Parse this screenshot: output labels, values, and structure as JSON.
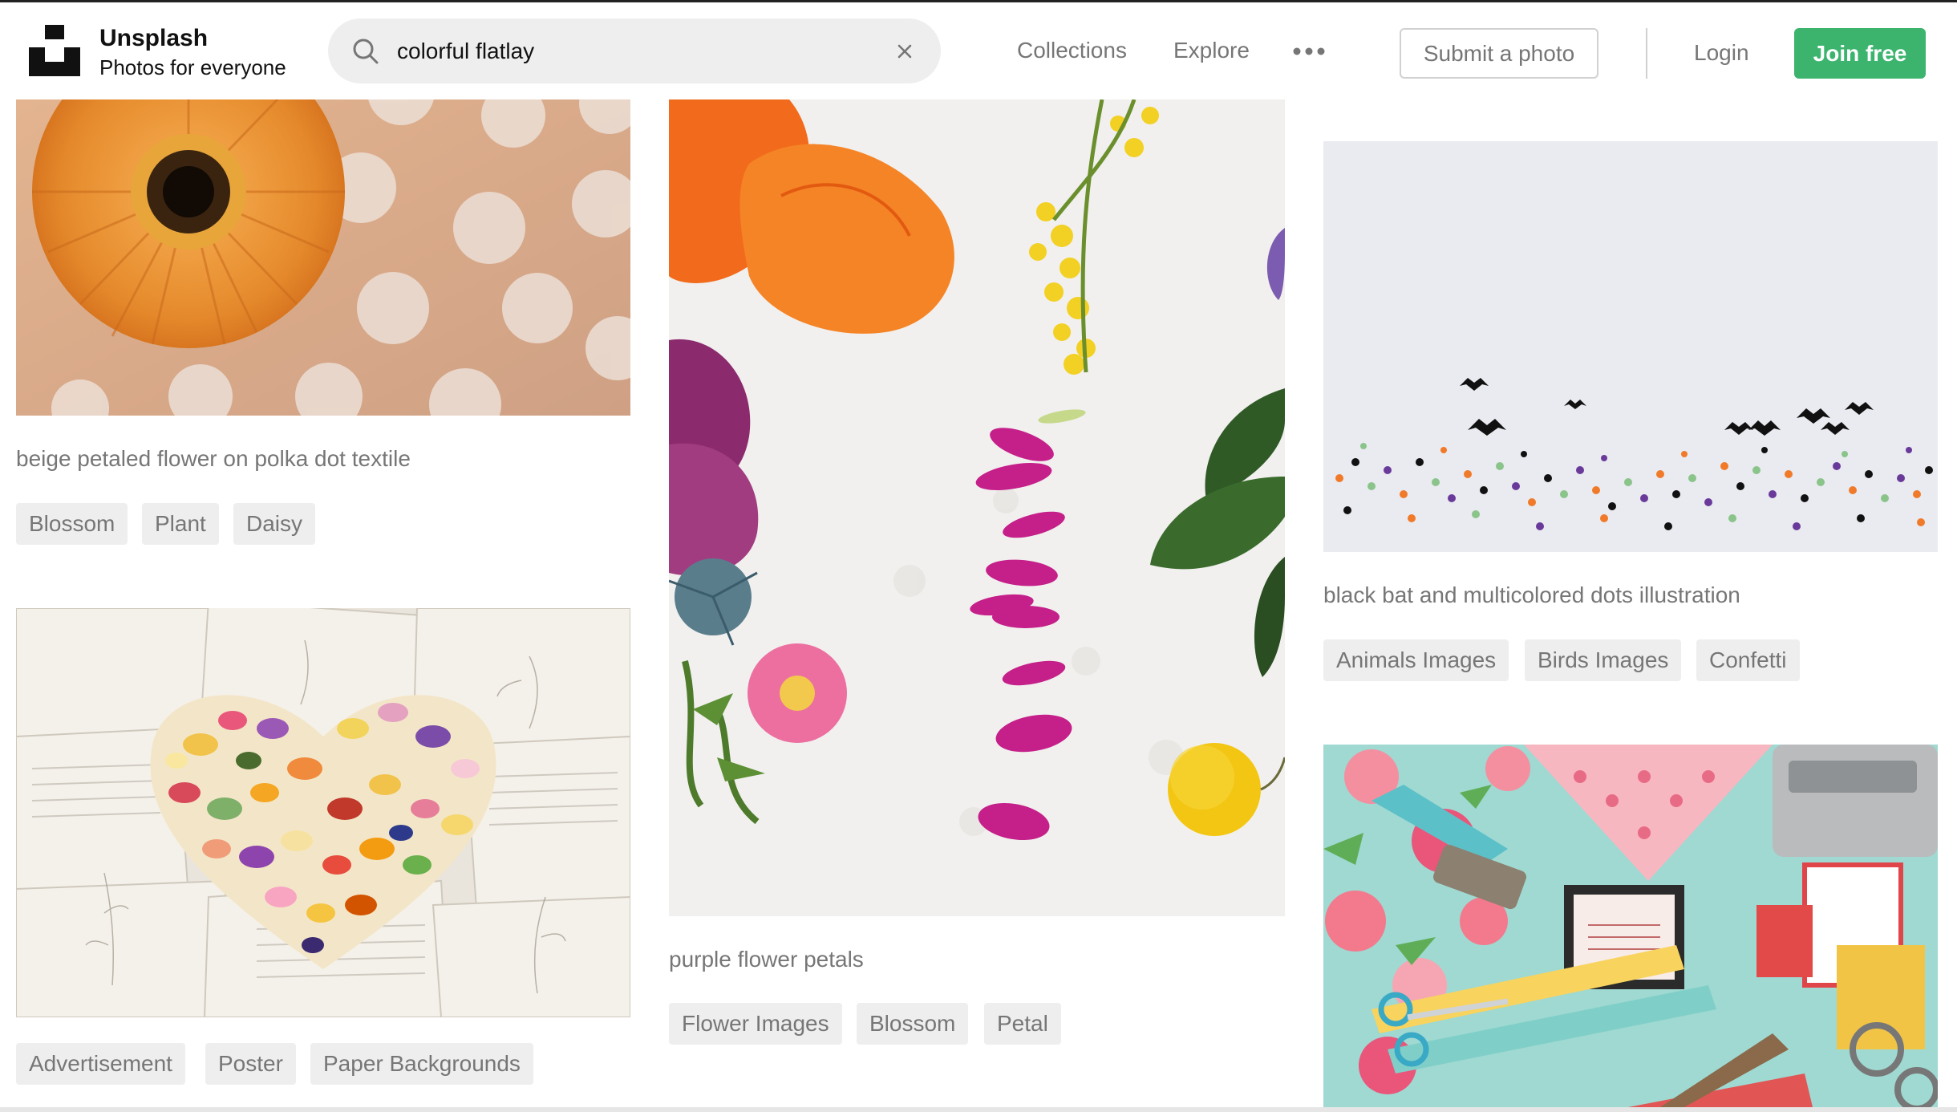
{
  "brand": {
    "name": "Unsplash",
    "tagline": "Photos for everyone"
  },
  "search": {
    "value": "colorful flatlay",
    "icon": "search-icon",
    "clear_icon": "close-icon"
  },
  "nav": {
    "collections": "Collections",
    "explore": "Explore",
    "more_icon": "more-horizontal-icon"
  },
  "actions": {
    "submit": "Submit a photo",
    "login": "Login",
    "join": "Join free"
  },
  "colors": {
    "accent": "#3cb46e",
    "muted_text": "#767676",
    "tag_bg": "#eeeeee"
  },
  "photos": [
    {
      "caption": "beige petaled flower on polka dot textile",
      "tags": [
        "Blossom",
        "Plant",
        "Daisy"
      ]
    },
    {
      "caption": "",
      "tags": [
        "Advertisement",
        "Poster",
        "Paper Backgrounds"
      ]
    },
    {
      "caption": "purple flower petals",
      "tags": [
        "Flower Images",
        "Blossom",
        "Petal"
      ]
    },
    {
      "caption": "black bat and multicolored dots illustration",
      "tags": [
        "Animals Images",
        "Birds Images",
        "Confetti"
      ]
    },
    {
      "caption": "",
      "tags": []
    }
  ]
}
